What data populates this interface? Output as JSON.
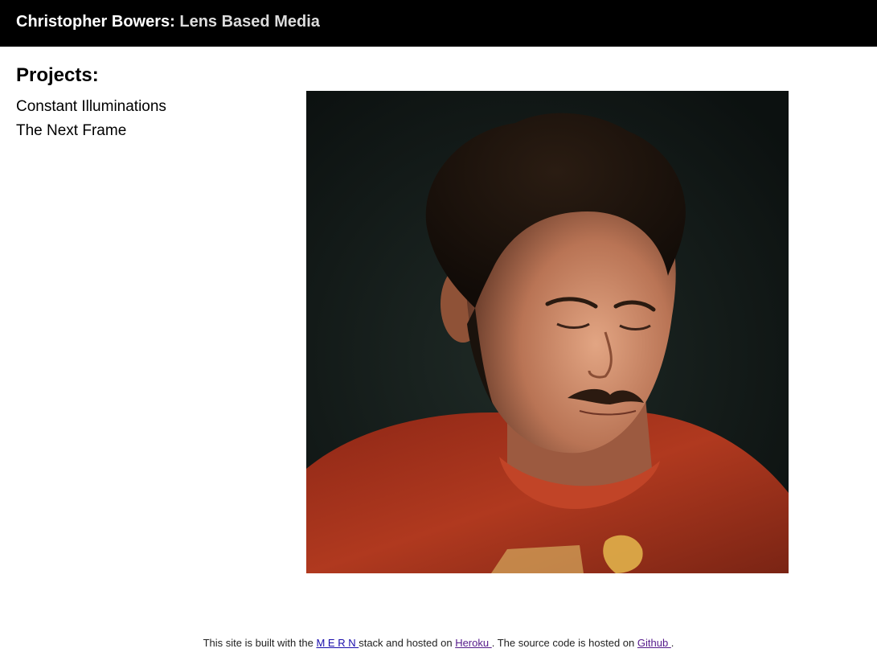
{
  "header": {
    "owner": "Christopher Bowers:",
    "subtitle": "Lens Based Media",
    "background": "#000000"
  },
  "sidebar": {
    "heading": "Projects:",
    "projects": [
      {
        "label": "Constant Illuminations"
      },
      {
        "label": "The Next Frame"
      }
    ]
  },
  "main": {
    "image": {
      "description": "Portrait of a young man with curly dark hair and a mustache, wearing a red t-shirt, face lit from below against a dark teal background",
      "colors": {
        "background": "#121917",
        "shirt": "#a5311c",
        "skin": "#c98768",
        "hair": "#1a120c"
      }
    }
  },
  "footer": {
    "text_1": "This site is built with the ",
    "mern_link": " M E R N ",
    "text_2": " stack and hosted on ",
    "heroku_link": " Heroku ",
    "text_3": ". The source code is hosted on ",
    "github_link": " Github ",
    "text_4": "."
  }
}
